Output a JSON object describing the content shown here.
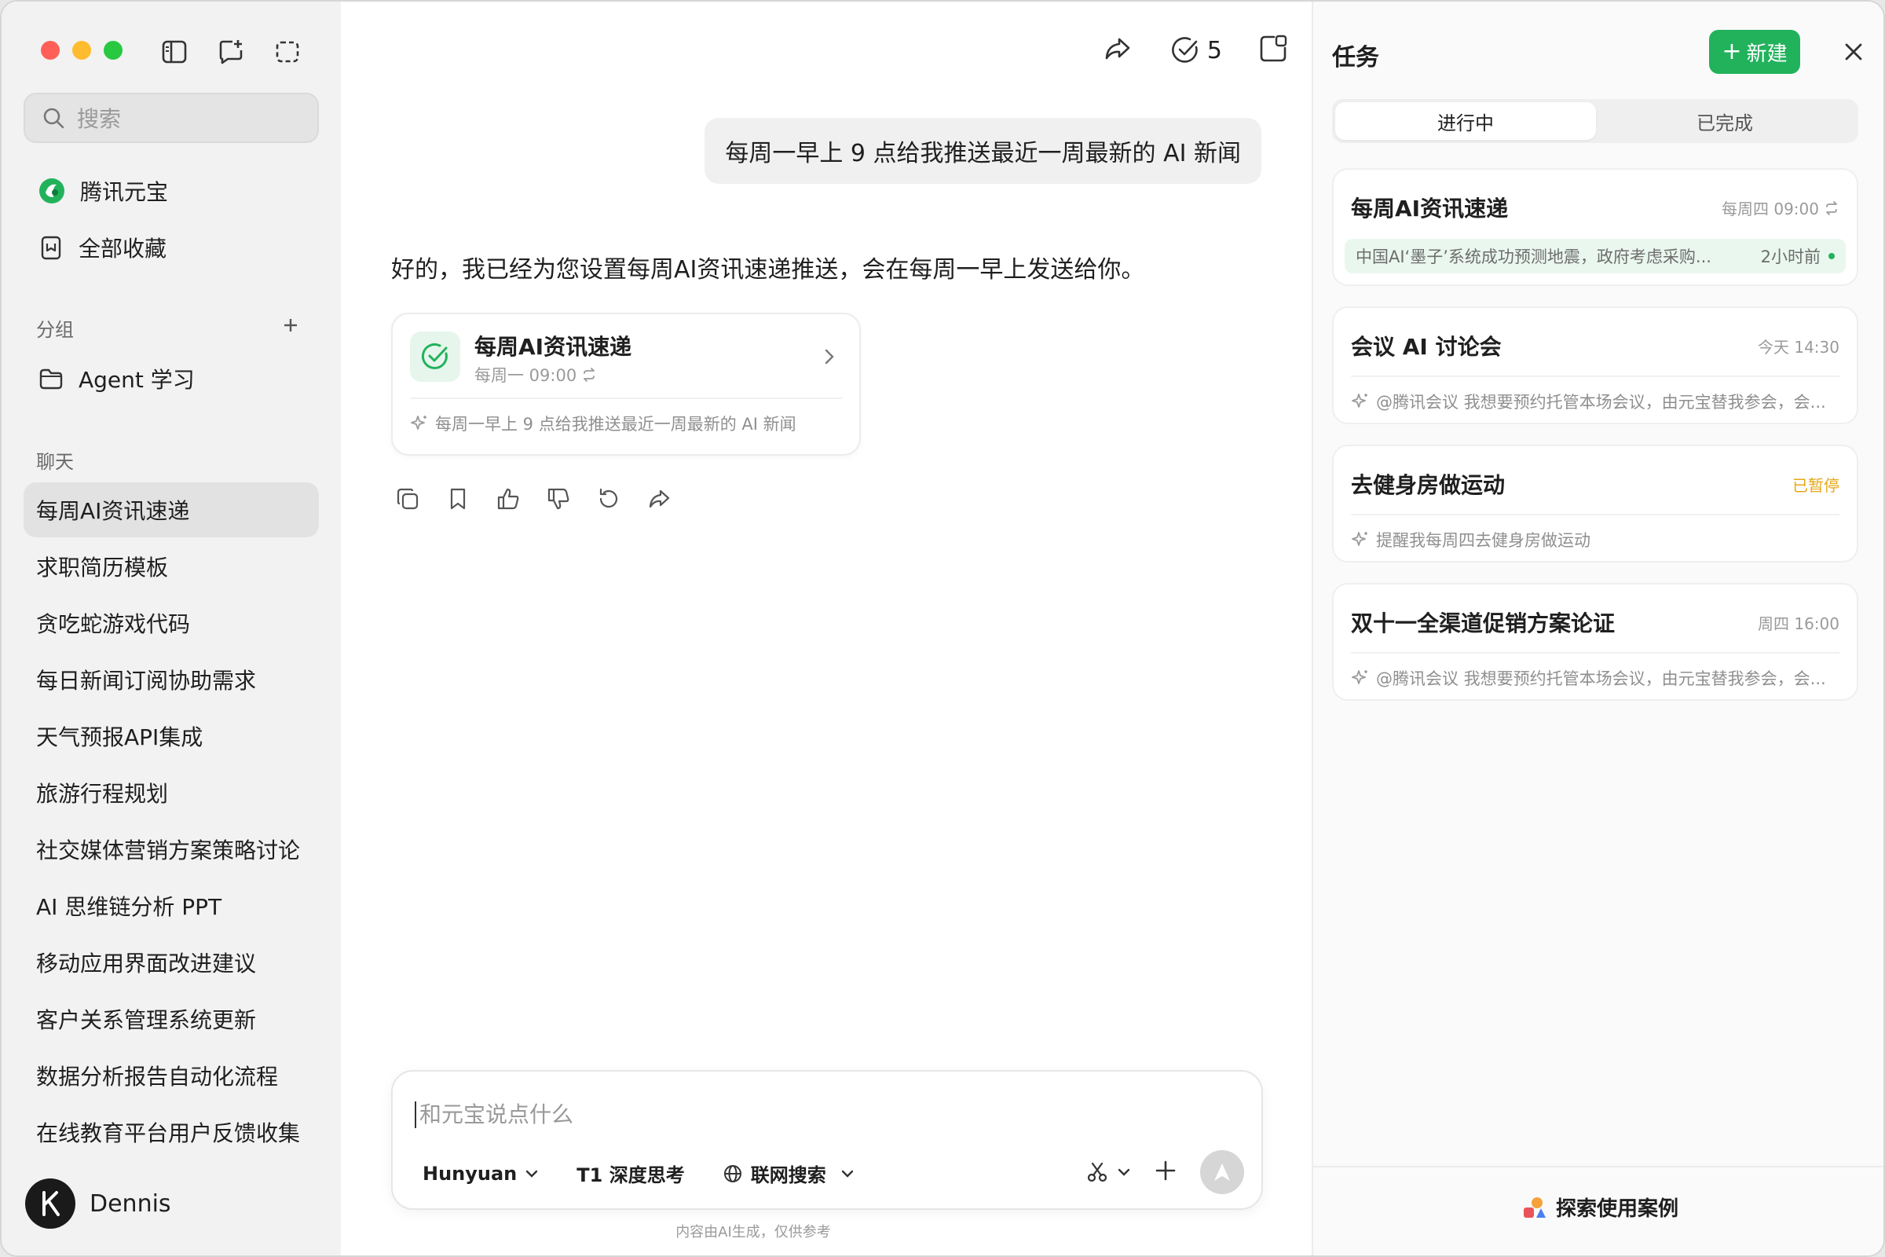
{
  "sidebar": {
    "search_placeholder": "搜索",
    "nav": [
      {
        "label": "腾讯元宝",
        "icon": "yuanbao-logo-icon"
      },
      {
        "label": "全部收藏",
        "icon": "bookmark-icon"
      }
    ],
    "groups_label": "分组",
    "groups": [
      {
        "label": "Agent 学习",
        "icon": "folder-icon"
      }
    ],
    "chats_label": "聊天",
    "chats": [
      "每周AI资讯速递",
      "求职简历模板",
      "贪吃蛇游戏代码",
      "每日新闻订阅协助需求",
      "天气预报API集成",
      "旅游行程规划",
      "社交媒体营销方案策略讨论",
      "AI 思维链分析 PPT",
      "移动应用界面改进建议",
      "客户关系管理系统更新",
      "数据分析报告自动化流程",
      "在线教育平台用户反馈收集"
    ],
    "user_name": "Dennis"
  },
  "main": {
    "task_count": "5",
    "user_message": "每周一早上 9 点给我推送最近一周最新的 AI 新闻",
    "assistant_message": "好的，我已经为您设置每周AI资讯速递推送，会在每周一早上发送给你。",
    "task_card": {
      "title": "每周AI资讯速递",
      "schedule": "每周一 09:00",
      "prompt": "每周一早上 9 点给我推送最近一周最新的 AI 新闻"
    },
    "composer": {
      "placeholder": "和元宝说点什么",
      "model": "Hunyuan",
      "deep_think": "T1 深度思考",
      "web_search": "联网搜索"
    },
    "disclaimer": "内容由AI生成，仅供参考"
  },
  "panel": {
    "title": "任务",
    "new_label": "新建",
    "tab_active": "进行中",
    "tab_done": "已完成",
    "tasks": [
      {
        "title": "每周AI资讯速递",
        "meta": "每周四 09:00",
        "news": "中国AI‘墨子’系统成功预测地震，政府考虑采购...",
        "ago": "2小时前"
      },
      {
        "title": "会议 AI 讨论会",
        "meta": "今天 14:30",
        "line": "@腾讯会议 我想要预约托管本场会议，由元宝替我参会，会..."
      },
      {
        "title": "去健身房做运动",
        "meta": "已暂停",
        "line": "提醒我每周四去健身房做运动"
      },
      {
        "title": "双十一全渠道促销方案论证",
        "meta": "周四 16:00",
        "line": "@腾讯会议 我想要预约托管本场会议，由元宝替我参会，会..."
      }
    ],
    "explore_label": "探索使用案例"
  },
  "colors": {
    "accent_green": "#22b25c",
    "paused_yellow": "#e6a817",
    "close_red": "#ff5f57",
    "min_yellow": "#febc2e",
    "max_green": "#28c840"
  }
}
